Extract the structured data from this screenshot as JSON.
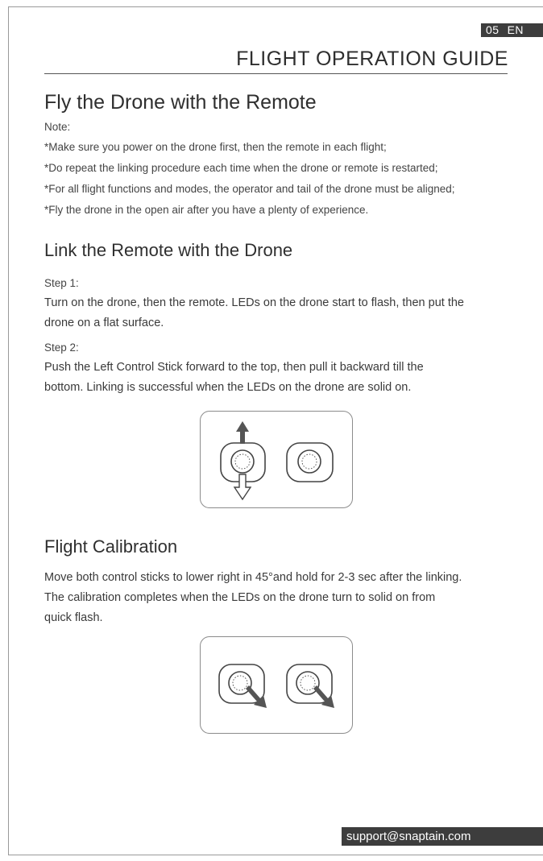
{
  "header": {
    "page_number": "05",
    "language": "EN",
    "title": "FLIGHT OPERATION GUIDE"
  },
  "section_fly": {
    "heading": "Fly the Drone with the Remote",
    "note_label": "Note:",
    "notes": [
      "*Make sure you power on the drone first, then the remote in each flight;",
      "*Do repeat the linking procedure each time when the drone or remote is restarted;",
      "*For all flight functions and modes, the operator and tail of the drone must be aligned;",
      "*Fly the drone in the open air after you have a plenty of experience."
    ]
  },
  "section_link": {
    "heading": "Link the Remote with the Drone",
    "step1_label": "Step 1:",
    "step1_lines": [
      "Turn on the drone, then the remote. LEDs on the drone start to flash, then put the",
      "drone on a flat surface."
    ],
    "step2_label": "Step 2:",
    "step2_lines": [
      "Push the Left Control Stick forward to the top, then pull it backward till the",
      "bottom. Linking is successful when the LEDs on the drone are solid on."
    ]
  },
  "section_calibration": {
    "heading": "Flight Calibration",
    "lines": [
      "Move both control sticks to lower right in 45°and hold for 2-3 sec after the linking.",
      "The calibration completes when the LEDs on the drone turn to solid on from",
      "quick flash."
    ]
  },
  "footer": {
    "email": "support@snaptain.com"
  },
  "colors": {
    "badge_bg": "#3d3d3d",
    "text": "#333333",
    "figure_border": "#8c8c8c"
  }
}
